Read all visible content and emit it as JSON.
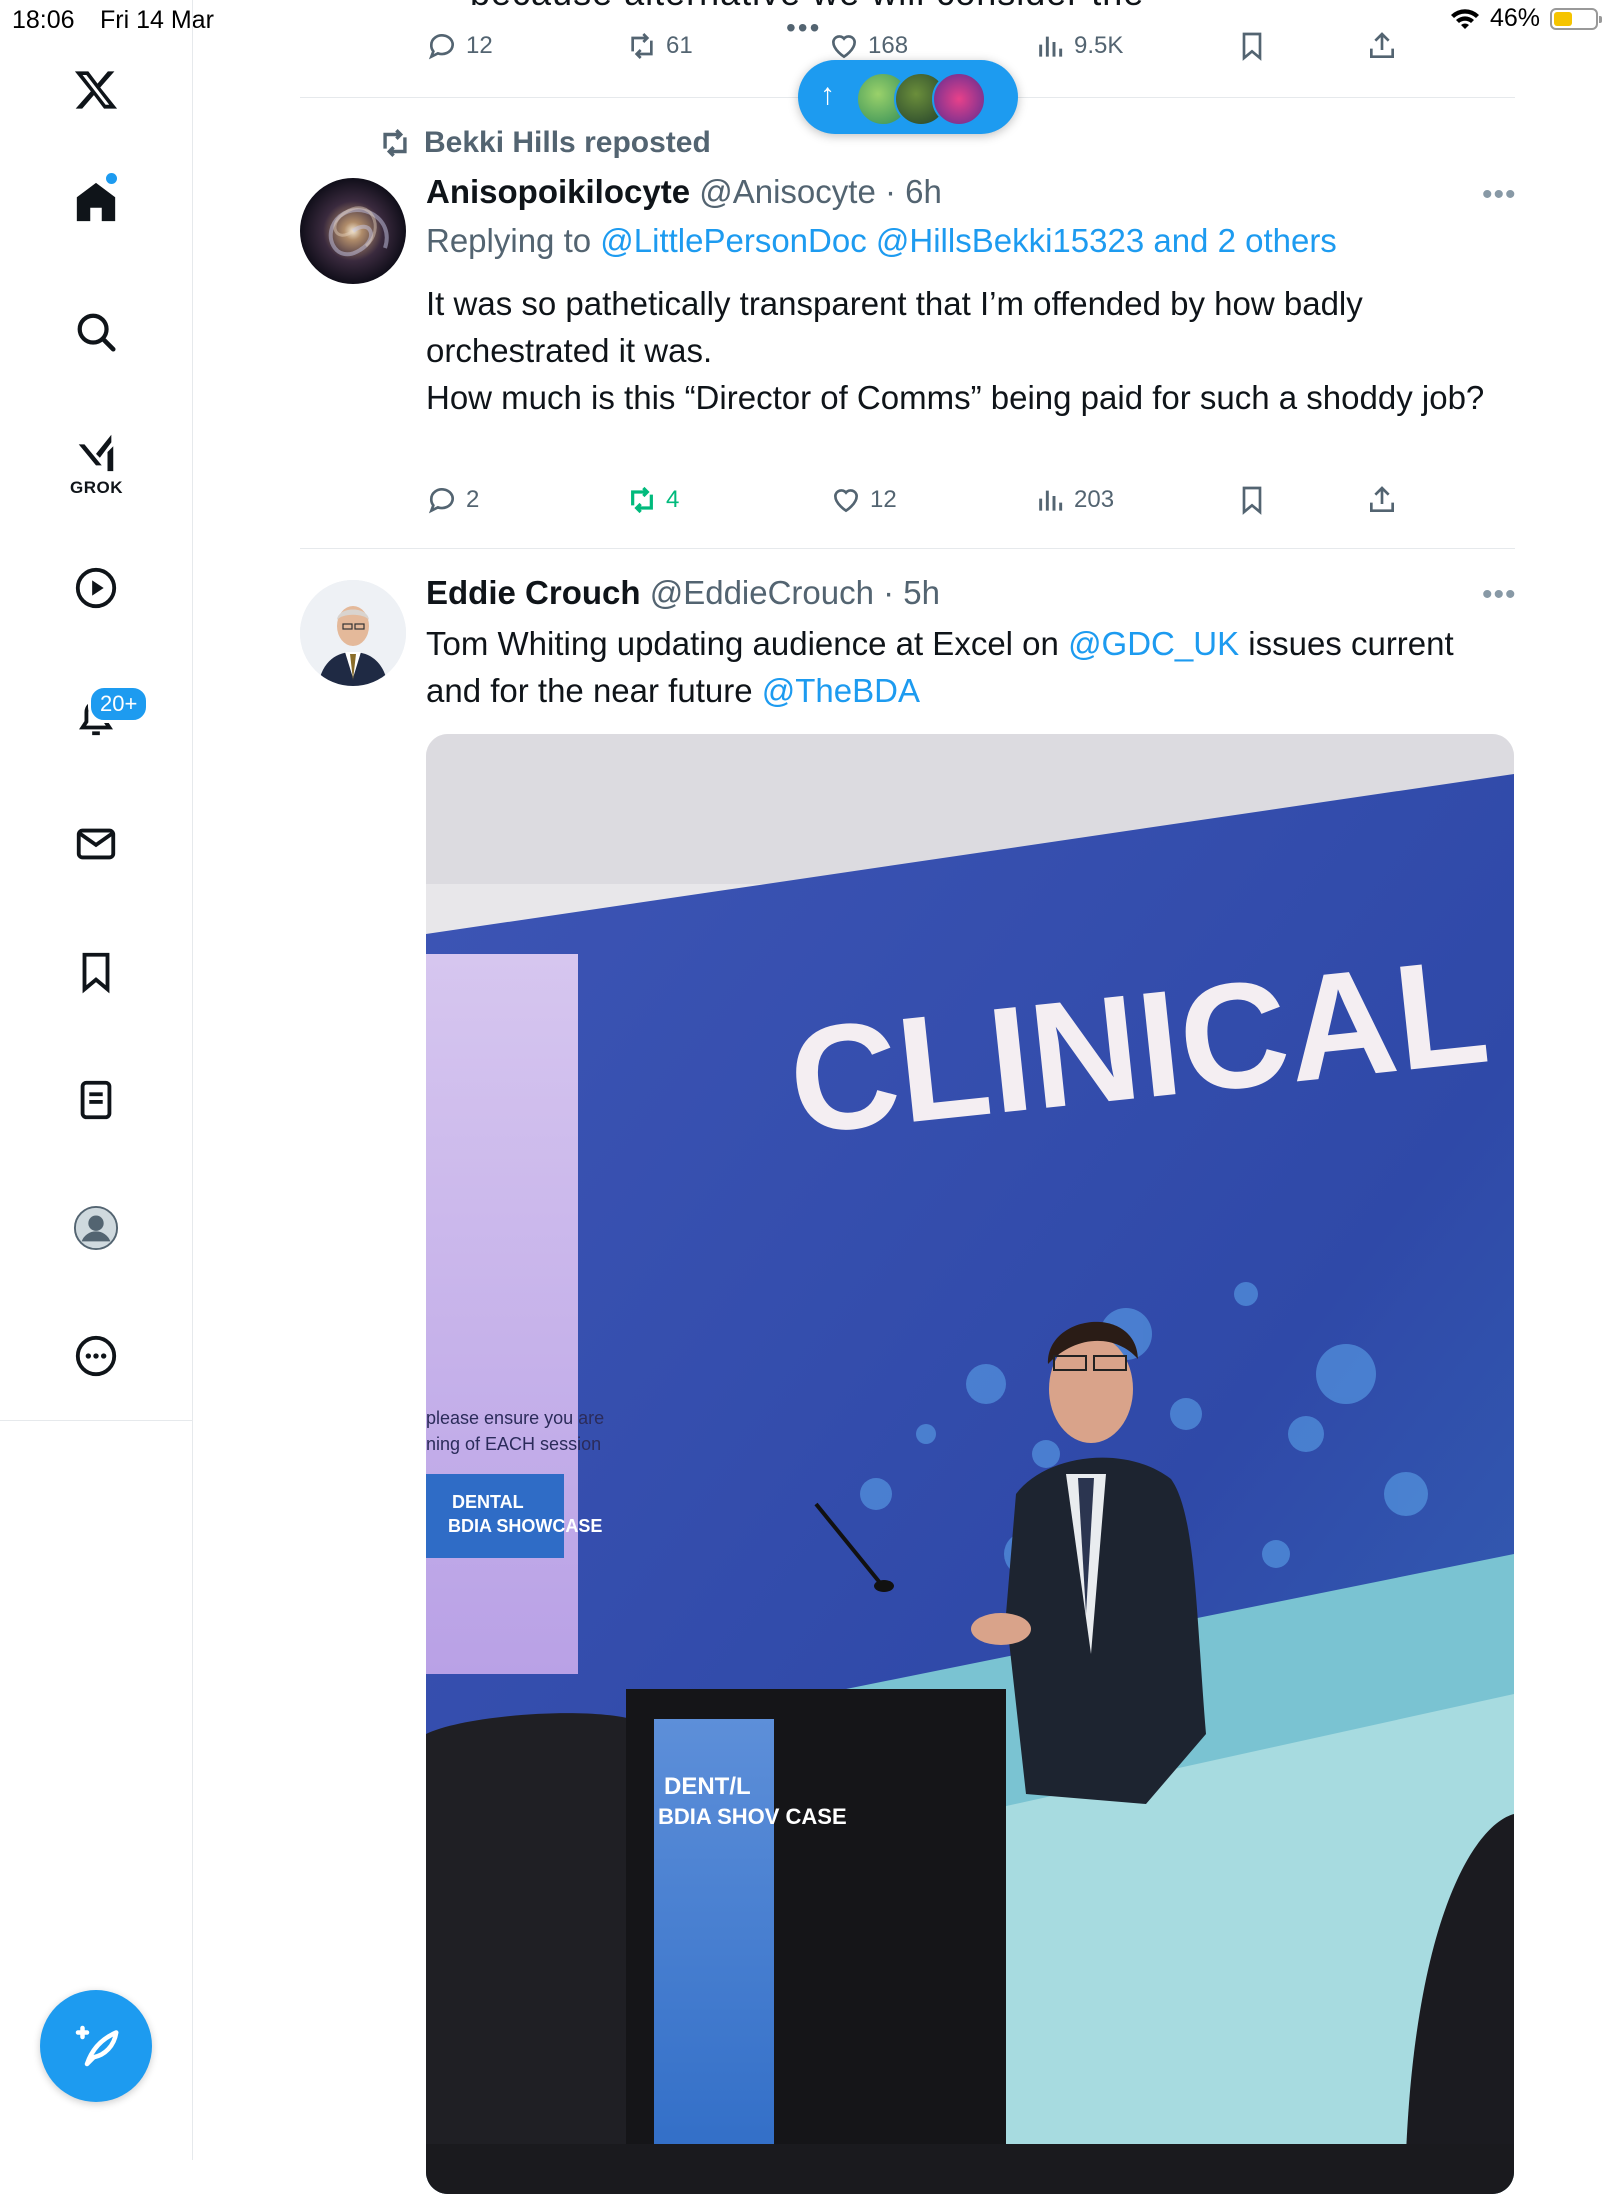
{
  "status_bar": {
    "time": "18:06",
    "date": "Fri 14 Mar",
    "battery": "46%"
  },
  "sidebar": {
    "items": [
      {
        "name": "home"
      },
      {
        "name": "explore"
      },
      {
        "name": "grok",
        "label": "GROK"
      },
      {
        "name": "video"
      },
      {
        "name": "notifications",
        "badge": "20+"
      },
      {
        "name": "messages"
      },
      {
        "name": "bookmarks"
      },
      {
        "name": "lists"
      },
      {
        "name": "profile"
      },
      {
        "name": "more"
      }
    ]
  },
  "top_tweet": {
    "partial_text": "because alternative we will consider the",
    "replies": "12",
    "reposts": "61",
    "likes": "168",
    "views": "9.5K"
  },
  "new_posts_pill": {
    "label": "↑"
  },
  "tweet1": {
    "reposted_by": "Bekki Hills reposted",
    "display_name": "Anisopoikilocyte",
    "handle_time": "@Anisocyte · 6h",
    "replying_prefix": "Replying to ",
    "replying_to": "@LittlePersonDoc @HillsBekki15323 and 2 others",
    "text_lines": [
      "It was so pathetically transparent that I’m offended by how badly orchestrated it was.",
      "How much is this “Director of Comms” being paid for such a shoddy job?"
    ],
    "replies": "2",
    "reposts": "4",
    "likes": "12",
    "views": "203"
  },
  "tweet2": {
    "display_name": "Eddie Crouch",
    "handle_time": "@EddieCrouch · 5h",
    "text_part1": "Tom Whiting updating audience at Excel on ",
    "mention1": "@GDC_UK",
    "text_part2": " issues current and for the near future ",
    "mention2": "@TheBDA",
    "image": {
      "stage_word": "CLINICAL",
      "screen_line1": "please ensure you are",
      "screen_line2": "ning of EACH session",
      "logo1": "DENTAL",
      "logo2": "BDIA SHOWCASE",
      "podium_logo1": "DENT/L",
      "podium_logo2": "BDIA SHOV CASE"
    }
  },
  "colors": {
    "accent": "#1d9bf0",
    "repost_active": "#00ba7c",
    "muted": "#536471"
  }
}
